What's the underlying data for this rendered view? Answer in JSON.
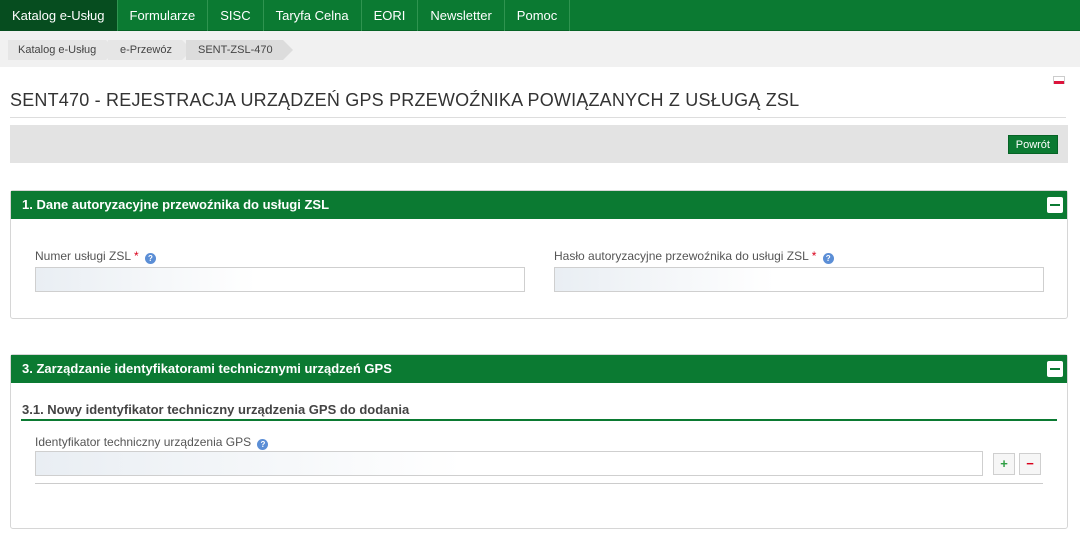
{
  "nav": {
    "items": [
      {
        "label": "Katalog e-Usług",
        "active": true
      },
      {
        "label": "Formularze"
      },
      {
        "label": "SISC"
      },
      {
        "label": "Taryfa Celna"
      },
      {
        "label": "EORI"
      },
      {
        "label": "Newsletter"
      },
      {
        "label": "Pomoc"
      }
    ]
  },
  "breadcrumb": [
    "Katalog e-Usług",
    "e-Przewóz",
    "SENT-ZSL-470"
  ],
  "page": {
    "title": "SENT470 - REJESTRACJA URZĄDZEŃ GPS PRZEWOŹNIKA POWIĄZANYCH Z USŁUGĄ ZSL",
    "back_label": "Powrót"
  },
  "section1": {
    "title": "1. Dane autoryzacyjne przewoźnika do usługi ZSL",
    "field_zsl_label": "Numer usługi ZSL",
    "field_zsl_value": "",
    "field_password_label": "Hasło autoryzacyjne przewoźnika do usługi ZSL",
    "field_password_value": "",
    "required_mark": "*",
    "help_glyph": "?"
  },
  "section3": {
    "title": "3. Zarządzanie identyfikatorami technicznymi urządzeń GPS",
    "subsection_title": "3.1. Nowy identyfikator techniczny urządzenia GPS do dodania",
    "field_gps_label": "Identyfikator techniczny urządzenia GPS",
    "field_gps_value": "",
    "add_glyph": "+",
    "remove_glyph": "−"
  },
  "colors": {
    "brand_green": "#0b7a32",
    "required_red": "#d9001b"
  },
  "icons": {
    "help": "question-circle-icon",
    "collapse": "minus-square-icon",
    "flag": "poland-flag-icon"
  }
}
